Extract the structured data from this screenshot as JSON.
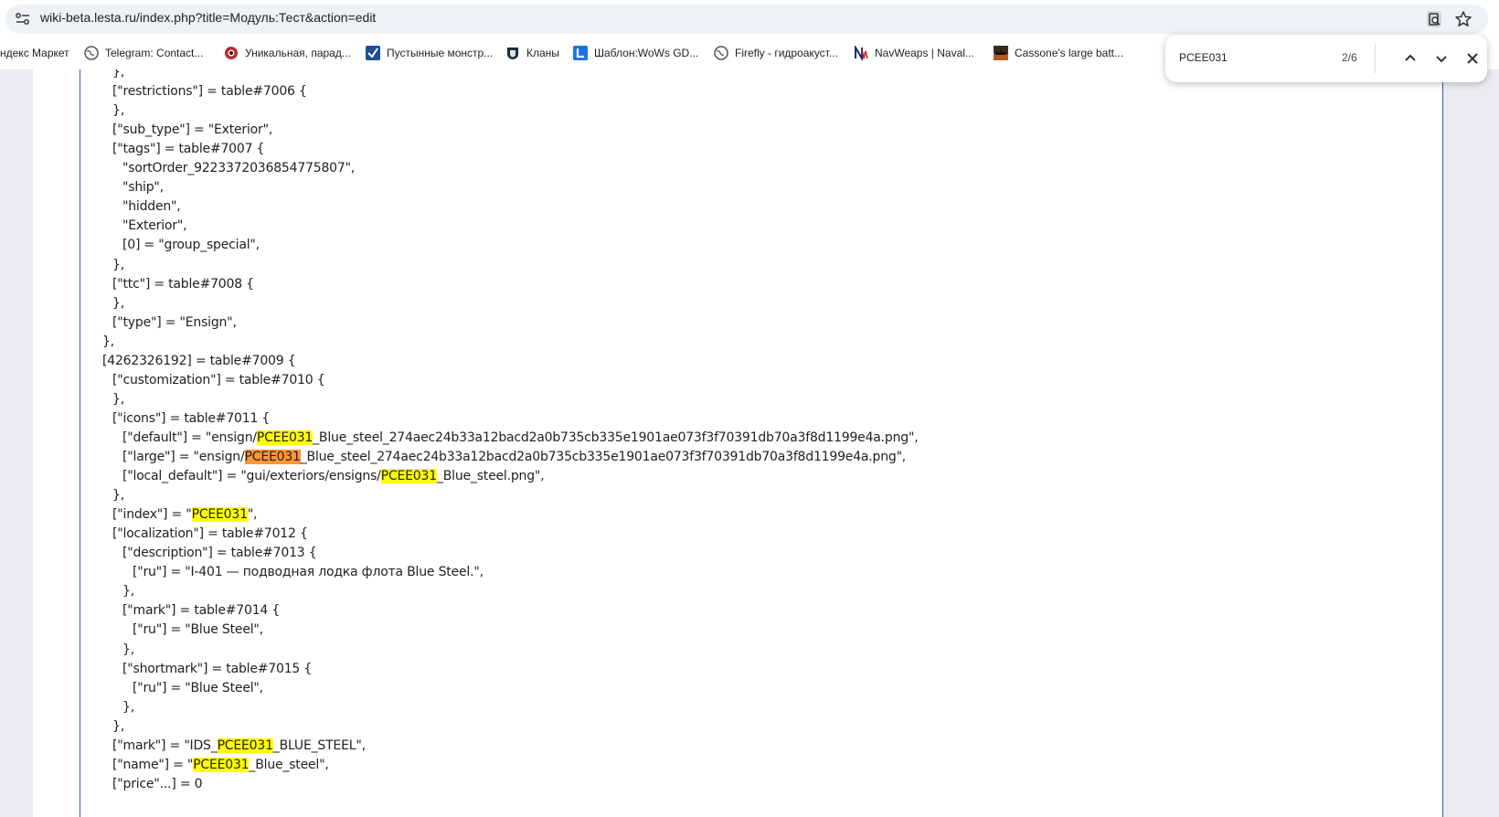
{
  "browser": {
    "url": "wiki-beta.lesta.ru/index.php?title=Модуль:Тест&action=edit",
    "bookmarks": [
      {
        "label": "ндекс Маркет"
      },
      {
        "label": "Telegram: Contact..."
      },
      {
        "label": "Уникальная, парад..."
      },
      {
        "label": "Пустынные монстр..."
      },
      {
        "label": "Кланы"
      },
      {
        "label": "Шаблон:WoWs GD..."
      },
      {
        "label": "Firefly - гидроакуст..."
      },
      {
        "label": "NavWeaps | Naval..."
      },
      {
        "label": "Cassone's large batt..."
      }
    ]
  },
  "find_bar": {
    "query": "PCEE031",
    "count": "2/6"
  },
  "code_lines": [
    {
      "parts": [
        {
          "t": "},"
        }
      ]
    },
    {
      "parts": [
        {
          "t": "[\"restrictions\"] = table#7006 {"
        }
      ]
    },
    {
      "parts": [
        {
          "t": "},"
        }
      ]
    },
    {
      "parts": [
        {
          "t": "[\"sub_type\"] = \"Exterior\","
        }
      ]
    },
    {
      "parts": [
        {
          "t": "[\"tags\"] = table#7007 {"
        }
      ]
    },
    {
      "parts": [
        {
          "t": "\"sortOrder_9223372036854775807\","
        }
      ]
    },
    {
      "parts": [
        {
          "t": "\"ship\","
        }
      ]
    },
    {
      "parts": [
        {
          "t": "\"hidden\","
        }
      ]
    },
    {
      "parts": [
        {
          "t": "\"Exterior\","
        }
      ]
    },
    {
      "parts": [
        {
          "t": "[0] = \"group_special\","
        }
      ]
    },
    {
      "parts": [
        {
          "t": "},"
        }
      ]
    },
    {
      "parts": [
        {
          "t": "[\"ttc\"] = table#7008 {"
        }
      ]
    },
    {
      "parts": [
        {
          "t": "},"
        }
      ]
    },
    {
      "parts": [
        {
          "t": "[\"type\"] = \"Ensign\","
        }
      ]
    },
    {
      "parts": [
        {
          "t": "},"
        }
      ]
    },
    {
      "parts": [
        {
          "t": "[4262326192] = table#7009 {"
        }
      ]
    },
    {
      "parts": [
        {
          "t": "[\"customization\"] = table#7010 {"
        }
      ]
    },
    {
      "parts": [
        {
          "t": "},"
        }
      ]
    },
    {
      "parts": [
        {
          "t": "[\"icons\"] = table#7011 {"
        }
      ]
    },
    {
      "parts": [
        {
          "t": "[\"default\"] = \"ensign/"
        },
        {
          "t": "PCEE031",
          "m": "hl"
        },
        {
          "t": "_Blue_steel_274aec24b33a12bacd2a0b735cb335e1901ae073f3f70391db70a3f8d1199e4a.png\","
        }
      ]
    },
    {
      "parts": [
        {
          "t": "[\"large\"] = \"ensign/"
        },
        {
          "t": "PCEE031",
          "m": "cur"
        },
        {
          "t": "_Blue_steel_274aec24b33a12bacd2a0b735cb335e1901ae073f3f70391db70a3f8d1199e4a.png\","
        }
      ]
    },
    {
      "parts": [
        {
          "t": "[\"local_default\"] = \"gui/exteriors/ensigns/"
        },
        {
          "t": "PCEE031",
          "m": "hl"
        },
        {
          "t": "_Blue_steel.png\","
        }
      ]
    },
    {
      "parts": [
        {
          "t": "},"
        }
      ]
    },
    {
      "parts": [
        {
          "t": "[\"index\"] = \""
        },
        {
          "t": "PCEE031",
          "m": "hl"
        },
        {
          "t": "\","
        }
      ]
    },
    {
      "parts": [
        {
          "t": "[\"localization\"] = table#7012 {"
        }
      ]
    },
    {
      "parts": [
        {
          "t": "[\"description\"] = table#7013 {"
        }
      ]
    },
    {
      "parts": [
        {
          "t": "[\"ru\"] = \"I-401 — подводная лодка флота Blue Steel.\","
        }
      ]
    },
    {
      "parts": [
        {
          "t": "},"
        }
      ]
    },
    {
      "parts": [
        {
          "t": "[\"mark\"] = table#7014 {"
        }
      ]
    },
    {
      "parts": [
        {
          "t": "[\"ru\"] = \"Blue Steel\","
        }
      ]
    },
    {
      "parts": [
        {
          "t": "},"
        }
      ]
    },
    {
      "parts": [
        {
          "t": "[\"shortmark\"] = table#7015 {"
        }
      ]
    },
    {
      "parts": [
        {
          "t": "[\"ru\"] = \"Blue Steel\","
        }
      ]
    },
    {
      "parts": [
        {
          "t": "},"
        }
      ]
    },
    {
      "parts": [
        {
          "t": "},"
        }
      ]
    },
    {
      "parts": [
        {
          "t": "[\"mark\"] = \"IDS_"
        },
        {
          "t": "PCEE031",
          "m": "hl"
        },
        {
          "t": "_BLUE_STEEL\","
        }
      ]
    },
    {
      "parts": [
        {
          "t": "[\"name\"] = \""
        },
        {
          "t": "PCEE031",
          "m": "hl"
        },
        {
          "t": "_Blue_steel\","
        }
      ]
    },
    {
      "parts": [
        {
          "t": "[\"price\"...] = 0"
        }
      ]
    }
  ]
}
